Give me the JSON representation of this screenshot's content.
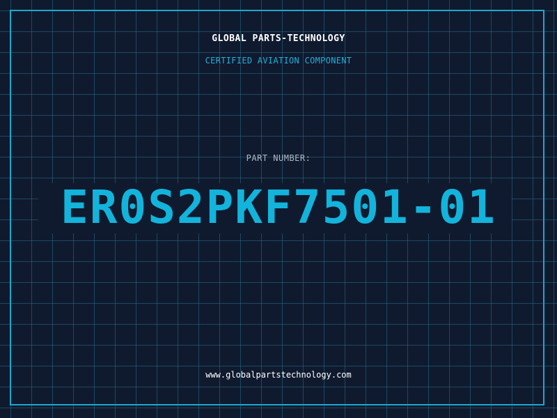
{
  "header": {
    "company": "GLOBAL PARTS-TECHNOLOGY",
    "subtitle": "CERTIFIED AVIATION COMPONENT"
  },
  "part": {
    "label": "PART NUMBER:",
    "number": "ER0S2PKF7501-01"
  },
  "footer": {
    "website": "www.globalpartstechnology.com"
  },
  "colors": {
    "background": "#101a2e",
    "grid": "#28829f",
    "accent": "#1aa9d0",
    "text_primary": "#ffffff",
    "text_muted": "#aeb8c6"
  }
}
